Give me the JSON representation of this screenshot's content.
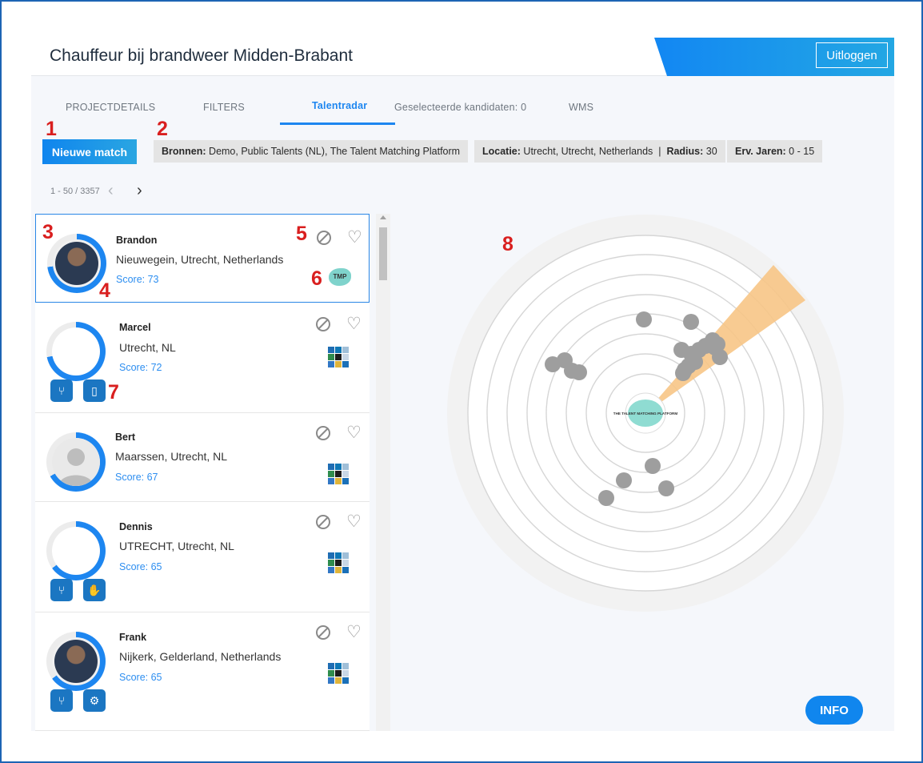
{
  "header": {
    "title": "Chauffeur bij brandweer Midden-Brabant",
    "logout_label": "Uitloggen"
  },
  "tabs": [
    {
      "label": "PROJECTDETAILS"
    },
    {
      "label": "FILTERS"
    },
    {
      "label": "Talentradar"
    },
    {
      "label": "Geselecteerde kandidaten: 0"
    },
    {
      "label": "WMS"
    }
  ],
  "toolbar": {
    "new_match_label": "Nieuwe match",
    "chip_sources_key": "Bronnen:",
    "chip_sources_value": " Demo, Public Talents (NL), The Talent Matching Platform",
    "chip_location_key": "Locatie:",
    "chip_location_value": " Utrecht, Utrecht, Netherlands",
    "chip_sep": "  |  ",
    "chip_radius_key": "Radius:",
    "chip_radius_value": " 30",
    "chip_exp_key": "Erv. Jaren:",
    "chip_exp_value": " 0 - 15"
  },
  "pager": {
    "range": "1 - 50 / 3357",
    "prev": "‹",
    "next": "›"
  },
  "candidates": [
    {
      "name": "Brandon",
      "location": "Nieuwegein, Utrecht, Netherlands",
      "score": "Score: 73",
      "score_value": 73,
      "avatar": "photo",
      "source": "tmp",
      "source_label": "TMP",
      "skills": []
    },
    {
      "name": "Marcel",
      "location": "Utrecht, NL",
      "score": "Score: 72",
      "score_value": 72,
      "avatar": "none",
      "source": "grid",
      "skills": [
        "fork-icon",
        "door-icon"
      ]
    },
    {
      "name": "Bert",
      "location": "Maarssen, Utrecht, NL",
      "score": "Score: 67",
      "score_value": 67,
      "avatar": "person",
      "source": "grid",
      "skills": []
    },
    {
      "name": "Dennis",
      "location": "UTRECHT, Utrecht, NL",
      "score": "Score: 65",
      "score_value": 65,
      "avatar": "none",
      "source": "grid",
      "skills": [
        "fork-icon",
        "handshake-icon"
      ]
    },
    {
      "name": "Frank",
      "location": "Nijkerk, Gelderland, Netherlands",
      "score": "Score: 65",
      "score_value": 65,
      "avatar": "photo",
      "source": "grid",
      "skills": [
        "fork-icon",
        "gears-icon"
      ]
    }
  ],
  "radar": {
    "center_logo_text": "THE TALENT MATCHING PLATFORM",
    "colors": {
      "rings": "#d6d6d6",
      "dots": "#9e9e9e",
      "beam": "#f7c586",
      "outer": "#f2f2f2"
    }
  },
  "annotations": [
    "1",
    "2",
    "3",
    "4",
    "5",
    "6",
    "7",
    "8"
  ],
  "info_label": "INFO",
  "colors": {
    "accent": "#1d86f0",
    "annotation": "#d91f1f",
    "score": "#2d8ef0"
  }
}
